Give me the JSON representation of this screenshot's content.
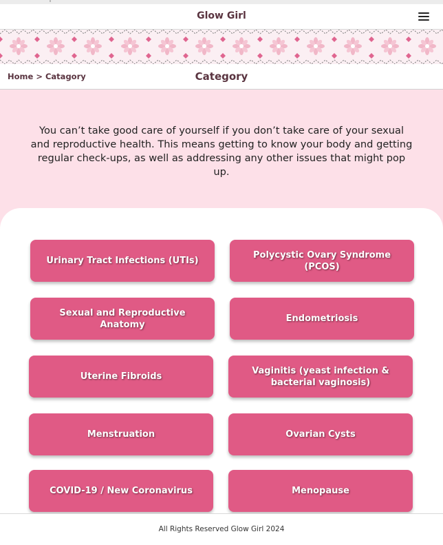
{
  "app": {
    "title": "Glow Girl"
  },
  "header": {
    "menu_icon": "hamburger-menu-icon"
  },
  "banner": {
    "pattern": "pink-floral-pattern",
    "colors": {
      "base": "#fbeff3",
      "flower": "#f1b7c8",
      "diamond": "#e06590",
      "zigzag": "#7a7a7a"
    }
  },
  "breadcrumb": {
    "home": "Home",
    "separator": ">",
    "current": "Catagory"
  },
  "page": {
    "title": "Category"
  },
  "intro": {
    "text": "You can’t take good care of yourself if you don’t take care of your sexual and reproductive health. This means getting to know your body and getting regular check-ups, as well as addressing any other issues that might pop up."
  },
  "categories": [
    {
      "label": "Urinary Tract Infections (UTIs)"
    },
    {
      "label": "Polycystic Ovary Syndrome (PCOS)"
    },
    {
      "label": "Sexual and Reproductive Anatomy"
    },
    {
      "label": "Endometriosis"
    },
    {
      "label": "Uterine Fibroids"
    },
    {
      "label": "Vaginitis (yeast infection & bacterial vaginosis)"
    },
    {
      "label": "Menstruation"
    },
    {
      "label": "Ovarian Cysts"
    },
    {
      "label": "COVID-19 / New Coronavirus"
    },
    {
      "label": "Menopause"
    }
  ],
  "footer": {
    "copyright": "All Rights Reserved Glow Girl 2024"
  },
  "colors": {
    "accent": "#e05a85",
    "section_bg": "#fde0e8",
    "text_dark": "#5a3440"
  }
}
